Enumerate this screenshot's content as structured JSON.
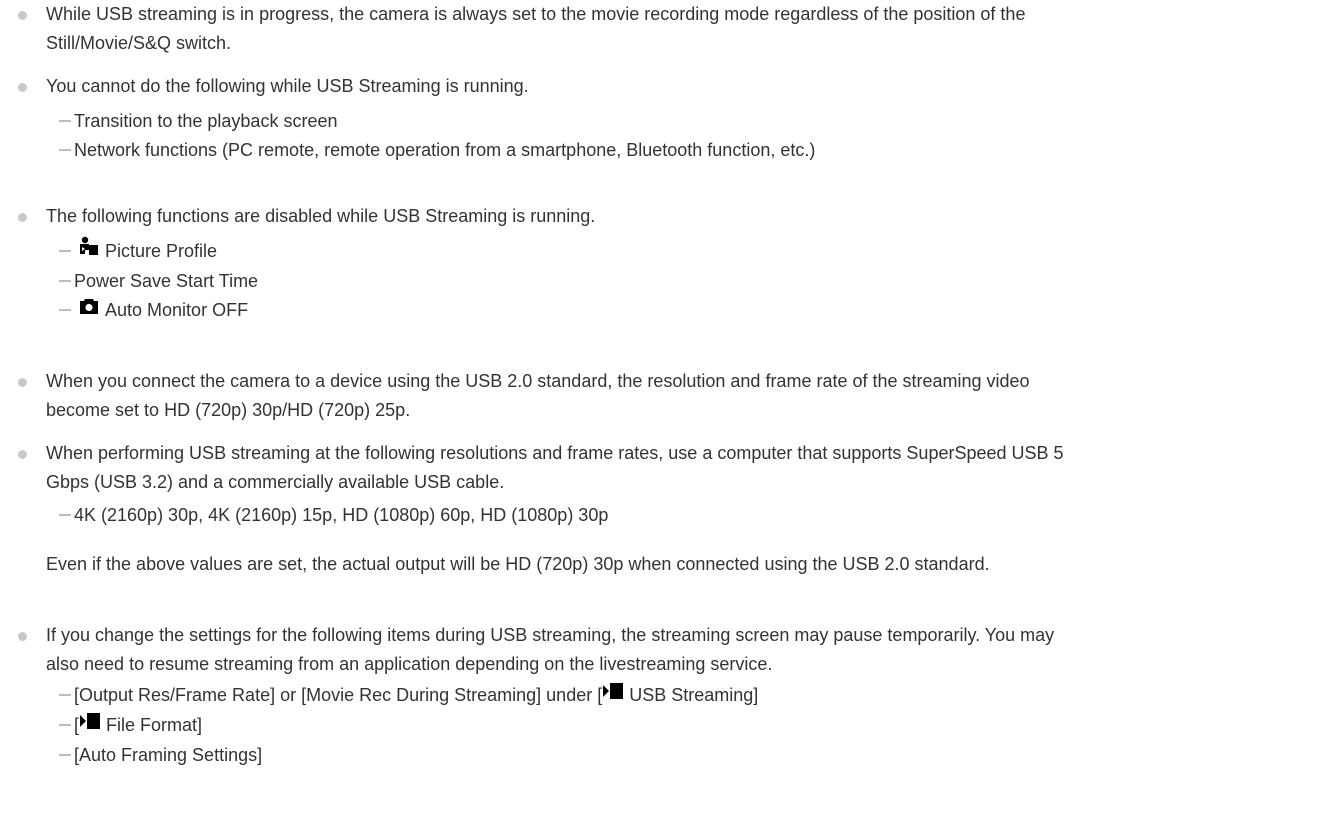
{
  "notes": [
    {
      "lines": [
        "While USB streaming is in progress, the camera is always set to the movie recording mode regardless of the position of the",
        "Still/Movie/S&Q switch."
      ]
    },
    {
      "text": "You cannot do the following while USB Streaming is running.",
      "items": [
        "Transition to the playback screen",
        "Network functions (PC remote, remote operation from a smartphone, Bluetooth function, etc.)"
      ]
    },
    {
      "text": "The following functions are disabled while USB Streaming is running.",
      "items": [
        {
          "icon": "picture-profile-icon",
          "label": "Picture Profile"
        },
        {
          "icon": "",
          "label": "Power Save Start Time"
        },
        {
          "icon": "still-camera-icon",
          "label": "Auto Monitor OFF"
        }
      ]
    },
    {
      "lines": [
        "When you connect the camera to a device using the USB 2.0 standard, the resolution and frame rate of the streaming video",
        "become set to HD (720p) 30p/HD (720p) 25p."
      ]
    },
    {
      "lines": [
        "When performing USB streaming at the following resolutions and frame rates, use a computer that supports SuperSpeed USB 5",
        "Gbps (USB 3.2) and a commercially available USB cable."
      ],
      "items": [
        "4K (2160p) 30p, 4K (2160p) 15p, HD (1080p) 60p, HD (1080p) 30p"
      ],
      "after": "Even if the above values are set, the actual output will be HD (720p) 30p when connected using the USB 2.0 standard."
    },
    {
      "lines": [
        "If you change the settings for the following items during USB streaming, the streaming screen may pause temporarily. You may",
        "also need to resume streaming from an application depending on the livestreaming service."
      ],
      "items": [
        {
          "pre": "[Output Res/Frame Rate] or [Movie Rec During Streaming] under [",
          "icon": "movie-icon",
          "post": " USB Streaming]"
        },
        {
          "pre": "[",
          "icon": "movie-icon",
          "post": " File Format]"
        },
        {
          "pre": "[Auto Framing Settings]",
          "icon": "",
          "post": ""
        }
      ]
    }
  ]
}
